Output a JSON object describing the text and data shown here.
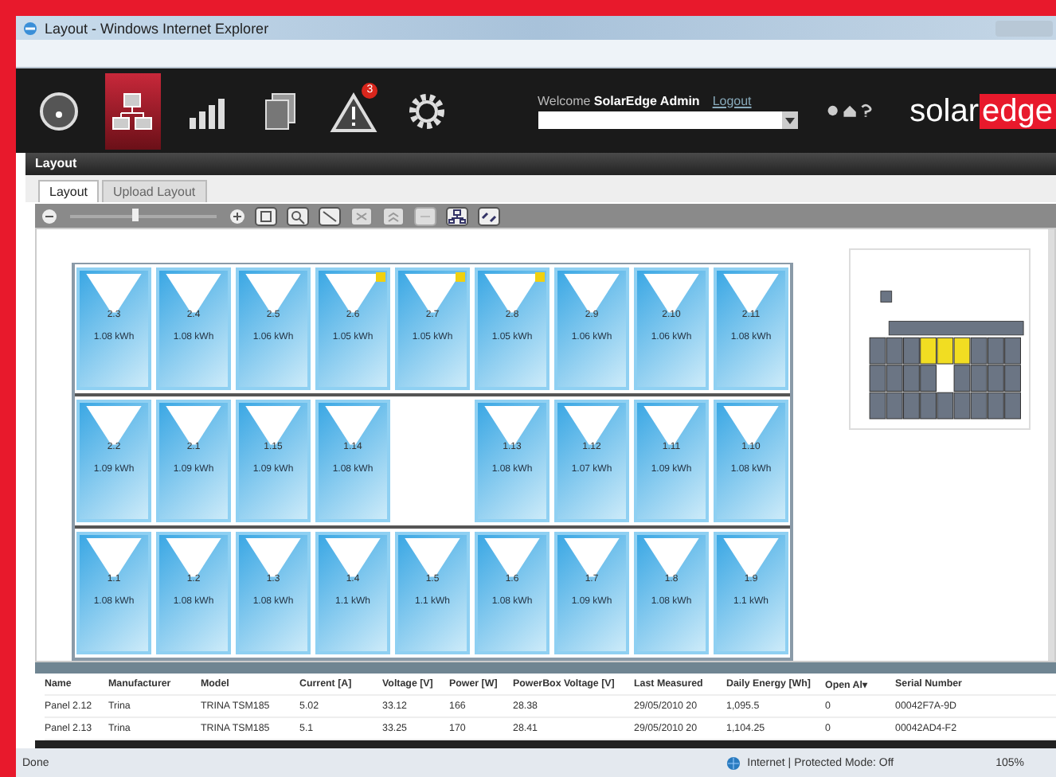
{
  "window": {
    "title": "Layout - Windows Internet Explorer"
  },
  "header": {
    "nav": [
      {
        "kind": "gauge",
        "selected": false
      },
      {
        "kind": "layout",
        "selected": true
      },
      {
        "kind": "bars",
        "selected": false
      },
      {
        "kind": "docs",
        "selected": false
      },
      {
        "kind": "alert",
        "selected": false,
        "badge": "3"
      },
      {
        "kind": "gear",
        "selected": false
      }
    ],
    "welcome": "Welcome",
    "user": "SolarEdge Admin",
    "logout": "Logout",
    "logo_left": "solar",
    "logo_right": "edge"
  },
  "panel_title": "Layout",
  "tabs": [
    {
      "label": "Layout",
      "selected": true
    },
    {
      "label": "Upload Layout",
      "selected": false
    }
  ],
  "zoom": {
    "level": 0.45
  },
  "rows": [
    [
      {
        "kind": "panel",
        "label": "2.3",
        "energy": "1.08 kWh",
        "alert": false
      },
      {
        "kind": "panel",
        "label": "2.4",
        "energy": "1.08 kWh",
        "alert": false
      },
      {
        "kind": "panel",
        "label": "2.5",
        "energy": "1.06 kWh",
        "alert": false
      },
      {
        "kind": "panel",
        "label": "2.6",
        "energy": "1.05 kWh",
        "alert": true
      },
      {
        "kind": "panel",
        "label": "2.7",
        "energy": "1.05 kWh",
        "alert": true
      },
      {
        "kind": "panel",
        "label": "2.8",
        "energy": "1.05 kWh",
        "alert": true
      },
      {
        "kind": "panel",
        "label": "2.9",
        "energy": "1.06 kWh",
        "alert": false
      },
      {
        "kind": "panel",
        "label": "2.10",
        "energy": "1.06 kWh",
        "alert": false
      },
      {
        "kind": "panel",
        "label": "2.11",
        "energy": "1.08 kWh",
        "alert": false
      }
    ],
    [
      {
        "kind": "panel",
        "label": "2.2",
        "energy": "1.09 kWh",
        "alert": false
      },
      {
        "kind": "panel",
        "label": "2.1",
        "energy": "1.09 kWh",
        "alert": false
      },
      {
        "kind": "panel",
        "label": "1.15",
        "energy": "1.09 kWh",
        "alert": false
      },
      {
        "kind": "panel",
        "label": "1.14",
        "energy": "1.08 kWh",
        "alert": false
      },
      {
        "kind": "gap"
      },
      {
        "kind": "panel",
        "label": "1.13",
        "energy": "1.08 kWh",
        "alert": false
      },
      {
        "kind": "panel",
        "label": "1.12",
        "energy": "1.07 kWh",
        "alert": false
      },
      {
        "kind": "panel",
        "label": "1.11",
        "energy": "1.09 kWh",
        "alert": false
      },
      {
        "kind": "panel",
        "label": "1.10",
        "energy": "1.08 kWh",
        "alert": false
      }
    ],
    [
      {
        "kind": "panel",
        "label": "1.1",
        "energy": "1.08 kWh",
        "alert": false
      },
      {
        "kind": "panel",
        "label": "1.2",
        "energy": "1.08 kWh",
        "alert": false
      },
      {
        "kind": "panel",
        "label": "1.3",
        "energy": "1.08 kWh",
        "alert": false
      },
      {
        "kind": "panel",
        "label": "1.4",
        "energy": "1.1 kWh",
        "alert": false
      },
      {
        "kind": "panel",
        "label": "1.5",
        "energy": "1.1 kWh",
        "alert": false
      },
      {
        "kind": "panel",
        "label": "1.6",
        "energy": "1.08 kWh",
        "alert": false
      },
      {
        "kind": "panel",
        "label": "1.7",
        "energy": "1.09 kWh",
        "alert": false
      },
      {
        "kind": "panel",
        "label": "1.8",
        "energy": "1.08 kWh",
        "alert": false
      },
      {
        "kind": "panel",
        "label": "1.9",
        "energy": "1.1 kWh",
        "alert": false
      }
    ]
  ],
  "table": {
    "columns": [
      "Name",
      "Manufacturer",
      "Model",
      "Current [A]",
      "Voltage [V]",
      "Power [W]",
      "PowerBox Voltage [V]",
      "Last Measured",
      "Daily Energy [Wh]",
      "Open Al▾",
      "Serial Number"
    ],
    "rows": [
      [
        "Panel 2.12",
        "Trina",
        "TRINA TSM185",
        "5.02",
        "33.12",
        "166",
        "28.38",
        "29/05/2010 20",
        "1,095.5",
        "0",
        "00042F7A-9D"
      ],
      [
        "Panel 2.13",
        "Trina",
        "TRINA TSM185",
        "5.1",
        "33.25",
        "170",
        "28.41",
        "29/05/2010 20",
        "1,104.25",
        "0",
        "00042AD4-F2"
      ]
    ]
  },
  "status_bar": {
    "left": "Done",
    "zone": "Internet | Protected Mode: Off",
    "zoom": "105%"
  }
}
